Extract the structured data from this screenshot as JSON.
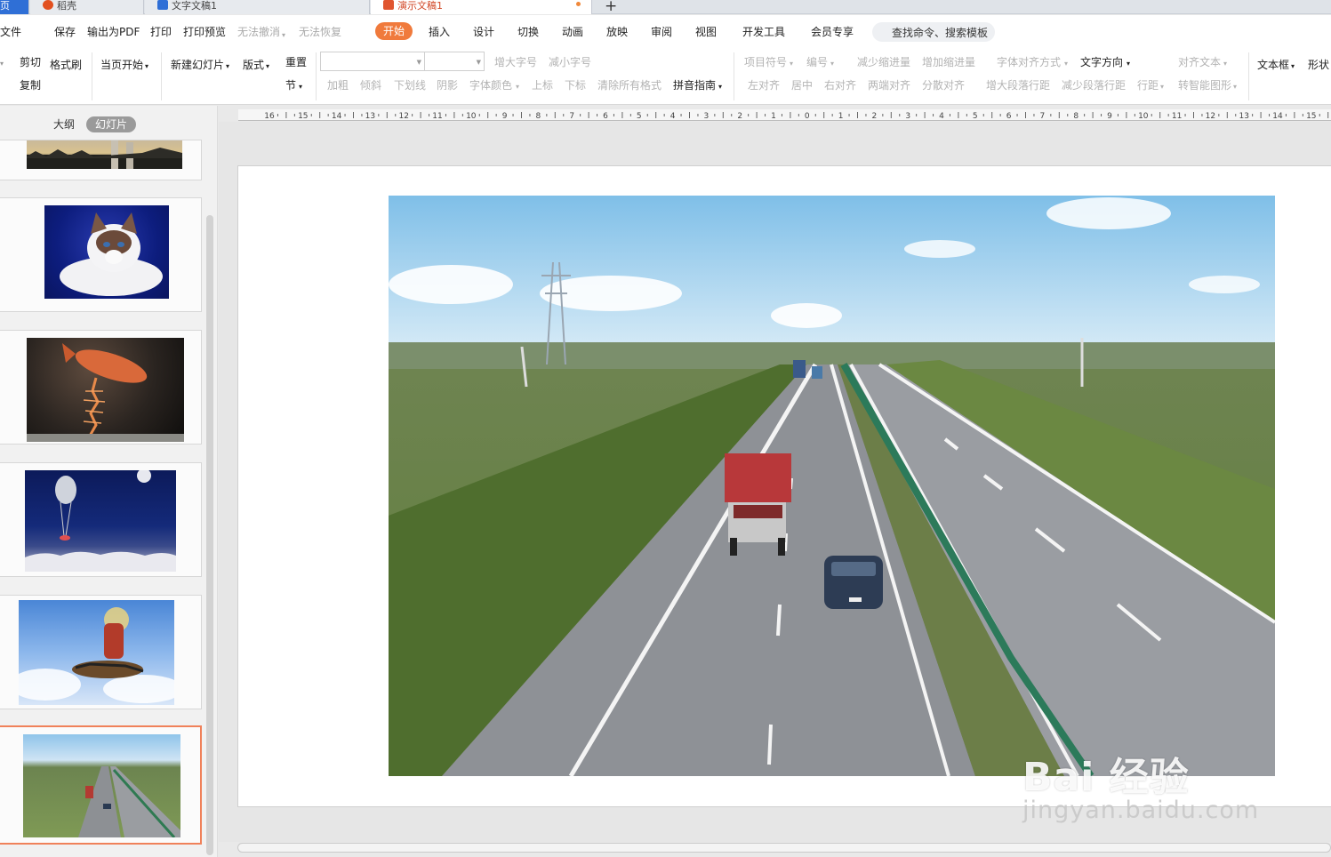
{
  "tabs": {
    "home": "页",
    "daoke": "稻壳",
    "word_doc": "文字文稿1",
    "ppt_doc": "演示文稿1",
    "add": "+"
  },
  "menu": {
    "file": "文件",
    "save": "保存",
    "export_pdf": "输出为PDF",
    "print": "打印",
    "print_preview": "打印预览",
    "undo": "无法撤消",
    "redo": "无法恢复",
    "start": "开始",
    "insert": "插入",
    "design": "设计",
    "transition": "切换",
    "animation": "动画",
    "slideshow": "放映",
    "review": "审阅",
    "view": "视图",
    "developer": "开发工具",
    "member": "会员专享",
    "search": "查找命令、搜索模板"
  },
  "ribbon": {
    "cut": "剪切",
    "copy": "复制",
    "format_painter": "格式刷",
    "from_first": "当页开始",
    "new_slide": "新建幻灯片",
    "layout": "版式",
    "reset": "重置",
    "section": "节",
    "font_name": "",
    "font_size": "",
    "increase_font": "增大字号",
    "decrease_font": "减小字号",
    "bold": "加粗",
    "italic": "倾斜",
    "underline": "下划线",
    "shadow": "阴影",
    "font_color": "字体颜色",
    "superscript": "上标",
    "subscript": "下标",
    "clear_format": "清除所有格式",
    "pinyin": "拼音指南",
    "bullets": "项目符号",
    "numbering": "编号",
    "decrease_indent": "减少缩进量",
    "increase_indent": "增加缩进量",
    "font_align": "字体对齐方式",
    "text_direction": "文字方向",
    "align_text": "对齐文本",
    "align_left": "左对齐",
    "align_center": "居中",
    "align_right": "右对齐",
    "justify": "两端对齐",
    "distribute": "分散对齐",
    "increase_spacing": "增大段落行距",
    "decrease_spacing": "减少段落行距",
    "line_spacing": "行距",
    "smartart": "转智能图形",
    "textbox": "文本框",
    "shape": "形状"
  },
  "panel": {
    "outline": "大纲",
    "slides": "幻灯片"
  },
  "ruler": {
    "labels": [
      "16",
      "15",
      "14",
      "13",
      "12",
      "11",
      "10",
      "9",
      "8",
      "7",
      "6",
      "5",
      "4",
      "3",
      "2",
      "1",
      "0",
      "1",
      "2",
      "3",
      "4",
      "5",
      "6",
      "7",
      "8",
      "9",
      "10",
      "11",
      "12",
      "13",
      "14",
      "15"
    ]
  },
  "watermark": {
    "logo": "Bai 经验",
    "url": "jingyan.baidu.com"
  },
  "colors": {
    "accent": "#f07a3c",
    "home_tab": "#2f6fd6",
    "selected_thumb": "#f0815a"
  }
}
